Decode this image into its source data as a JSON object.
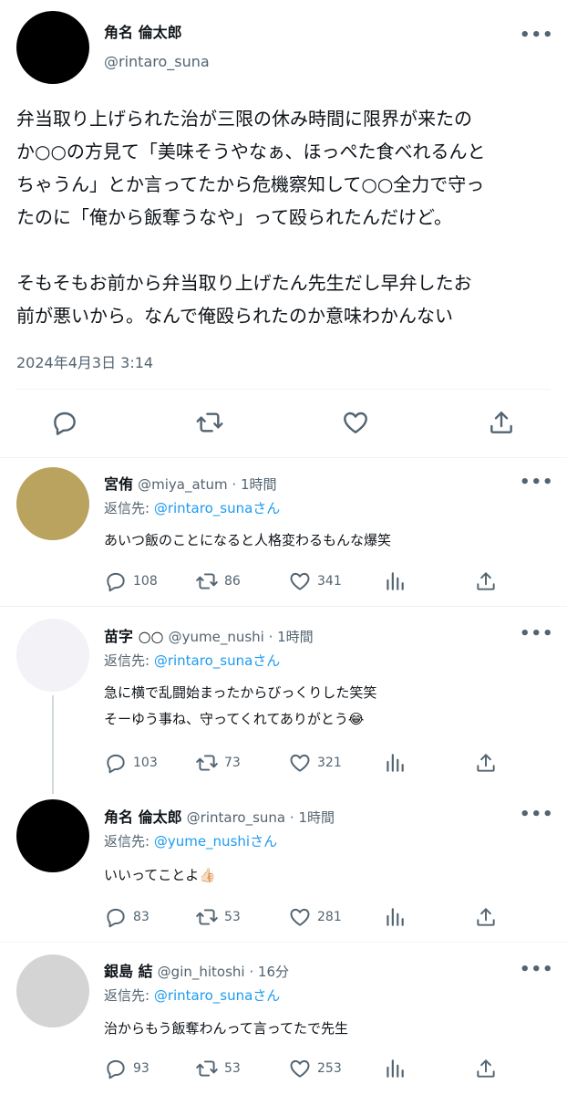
{
  "main_post": {
    "author_name": "角名 倫太郎",
    "handle": "@rintaro_suna",
    "body_lines": [
      "弁当取り上げられた治が三限の休み時間に限界が来たの",
      "か○○の方見て「美味そうやなぁ、ほっぺた食べれるんと",
      "ちゃうん」とか言ってたから危機察知して○○全力で守っ",
      "たのに「俺から飯奪うなや」って殴られたんだけど。",
      "",
      "そもそもお前から弁当取り上げたん先生だし早弁したお",
      "前が悪いから。なんで俺殴られたのか意味わかんない"
    ],
    "timestamp": "2024年4月3日 3:14",
    "avatar_color": "#000000"
  },
  "replies": [
    {
      "author_name": "宮侑",
      "handle": "@miya_atum",
      "time": "1時間",
      "reply_prefix": "返信先: ",
      "reply_to": "@rintaro_suna",
      "reply_suffix": "さん",
      "text_lines": [
        "あいつ飯のことになると人格変わるもんな爆笑"
      ],
      "replies": "108",
      "retweets": "86",
      "likes": "341",
      "avatar_color": "#b9a35f"
    },
    {
      "author_name": "苗字 ○○",
      "handle": "@yume_nushi",
      "time": "1時間",
      "reply_prefix": "返信先: ",
      "reply_to": "@rintaro_suna",
      "reply_suffix": "さん",
      "text_lines": [
        "急に横で乱闘始まったからびっくりした笑笑",
        "そーゆう事ね、守ってくれてありがとう😂"
      ],
      "replies": "103",
      "retweets": "73",
      "likes": "321",
      "avatar_color": "#f2f2f7"
    },
    {
      "author_name": "角名 倫太郎",
      "handle": "@rintaro_suna",
      "time": "1時間",
      "reply_prefix": "返信先: ",
      "reply_to": "@yume_nushi",
      "reply_suffix": "さん",
      "text_lines": [
        "いいってことよ👍🏻"
      ],
      "replies": "83",
      "retweets": "53",
      "likes": "281",
      "avatar_color": "#000000"
    },
    {
      "author_name": "銀島 結",
      "handle": "@gin_hitoshi",
      "time": "16分",
      "reply_prefix": "返信先: ",
      "reply_to": "@rintaro_suna",
      "reply_suffix": "さん",
      "text_lines": [
        "治からもう飯奪わんって言ってたで先生"
      ],
      "replies": "93",
      "retweets": "53",
      "likes": "253",
      "avatar_color": "#d4d4d4"
    }
  ],
  "separator": " · ",
  "more_glyph": "•••",
  "colors": {
    "accent": "#1d9bf0",
    "secondary_text": "#536471",
    "divider": "#eff3f4"
  }
}
